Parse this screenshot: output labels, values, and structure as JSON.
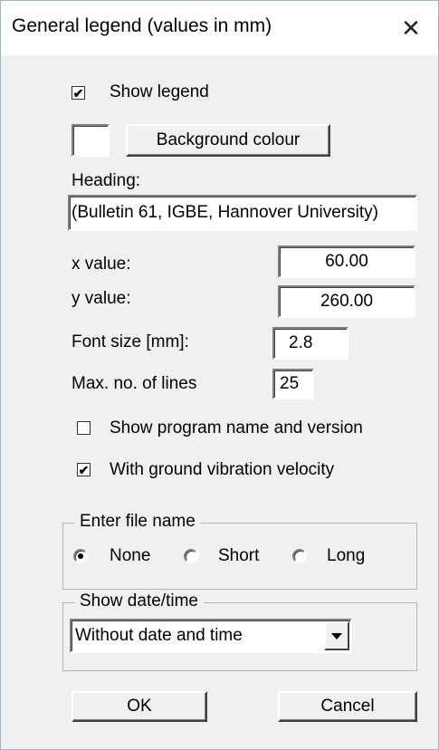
{
  "window": {
    "title": "General legend (values in mm)",
    "close_glyph": "✕"
  },
  "legend": {
    "show_legend_label": "Show legend",
    "show_legend_checked": true,
    "background_button_label": "Background colour",
    "background_colour": "#ffffff",
    "heading_label": "Heading:",
    "heading_value": "(Bulletin 61, IGBE, Hannover University)",
    "x_label": "x value:",
    "x_value": "60.00",
    "y_label": "y value:",
    "y_value": "260.00",
    "font_size_label": "Font size [mm]:",
    "font_size_value": "2.8",
    "max_lines_label": "Max. no. of lines",
    "max_lines_value": "25",
    "show_program_label": "Show program name and version",
    "show_program_checked": false,
    "ground_vibration_label": "With ground vibration velocity",
    "ground_vibration_checked": true
  },
  "file_name": {
    "group_title": "Enter file name",
    "options": [
      "None",
      "Short",
      "Long"
    ],
    "selected": "None"
  },
  "date_time": {
    "group_title": "Show date/time",
    "selected": "Without date and time"
  },
  "buttons": {
    "ok": "OK",
    "cancel": "Cancel"
  },
  "check_glyph": "✔"
}
